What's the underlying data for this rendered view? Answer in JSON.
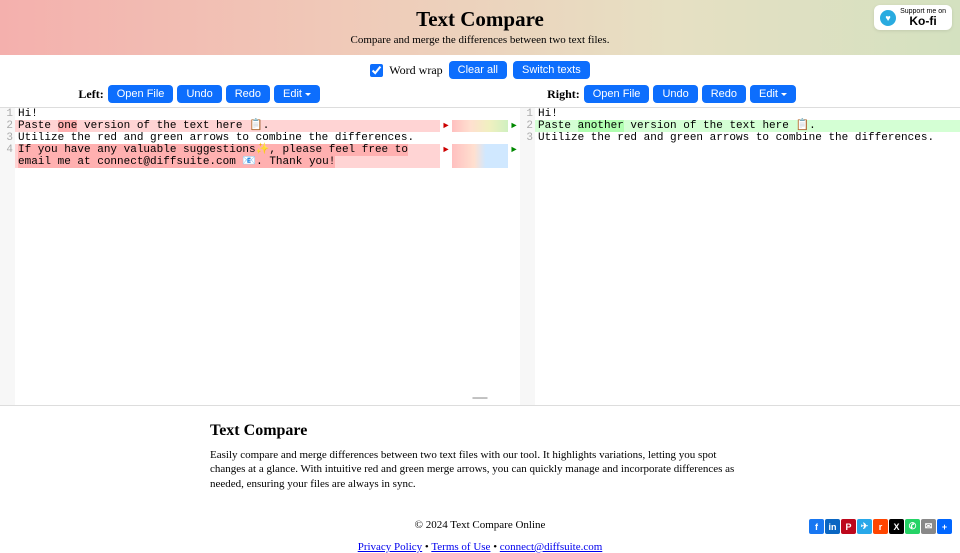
{
  "header": {
    "title": "Text Compare",
    "subtitle": "Compare and merge the differences between two text files."
  },
  "kofi": {
    "support": "Support me on",
    "brand": "Ko-fi"
  },
  "controls": {
    "wordwrap": "Word wrap",
    "clear_all": "Clear all",
    "switch": "Switch texts"
  },
  "panes": {
    "left": {
      "label": "Left:",
      "open": "Open File",
      "undo": "Undo",
      "redo": "Redo",
      "edit": "Edit"
    },
    "right": {
      "label": "Right:",
      "open": "Open File",
      "undo": "Undo",
      "redo": "Redo",
      "edit": "Edit"
    }
  },
  "left_lines": {
    "l1": "Hi!",
    "l2a": "Paste ",
    "l2b": "one",
    "l2c": " version of the text here 📋.",
    "l3": "Utilize the red and green arrows to combine the differences.",
    "l4": "If you have any valuable suggestions✨, please feel free to email me at connect@diffsuite.com 📧. Thank you!"
  },
  "right_lines": {
    "l1": "Hi!",
    "l2a": "Paste ",
    "l2b": "another",
    "l2c": " version of the text here 📋.",
    "l3": "Utilize the red and green arrows to combine the differences."
  },
  "article": {
    "title": "Text Compare",
    "body": "Easily compare and merge differences between two text files with our tool. It highlights variations, letting you spot changes at a glance. With intuitive red and green merge arrows, you can quickly manage and incorporate differences as needed, ensuring your files are always in sync."
  },
  "footer": {
    "copyright": "© 2024 Text Compare Online",
    "privacy": "Privacy Policy",
    "terms": "Terms of Use",
    "email": "connect@diffsuite.com",
    "sep": " • "
  },
  "social": [
    {
      "name": "facebook",
      "bg": "#1877f2",
      "t": "f"
    },
    {
      "name": "linkedin",
      "bg": "#0a66c2",
      "t": "in"
    },
    {
      "name": "pinterest",
      "bg": "#bd081c",
      "t": "P"
    },
    {
      "name": "telegram",
      "bg": "#28a8e9",
      "t": "✈"
    },
    {
      "name": "reddit",
      "bg": "#ff4500",
      "t": "r"
    },
    {
      "name": "x",
      "bg": "#000",
      "t": "X"
    },
    {
      "name": "whatsapp",
      "bg": "#25d366",
      "t": "✆"
    },
    {
      "name": "email",
      "bg": "#888",
      "t": "✉"
    },
    {
      "name": "share",
      "bg": "#0o6eff",
      "t": "+"
    }
  ]
}
